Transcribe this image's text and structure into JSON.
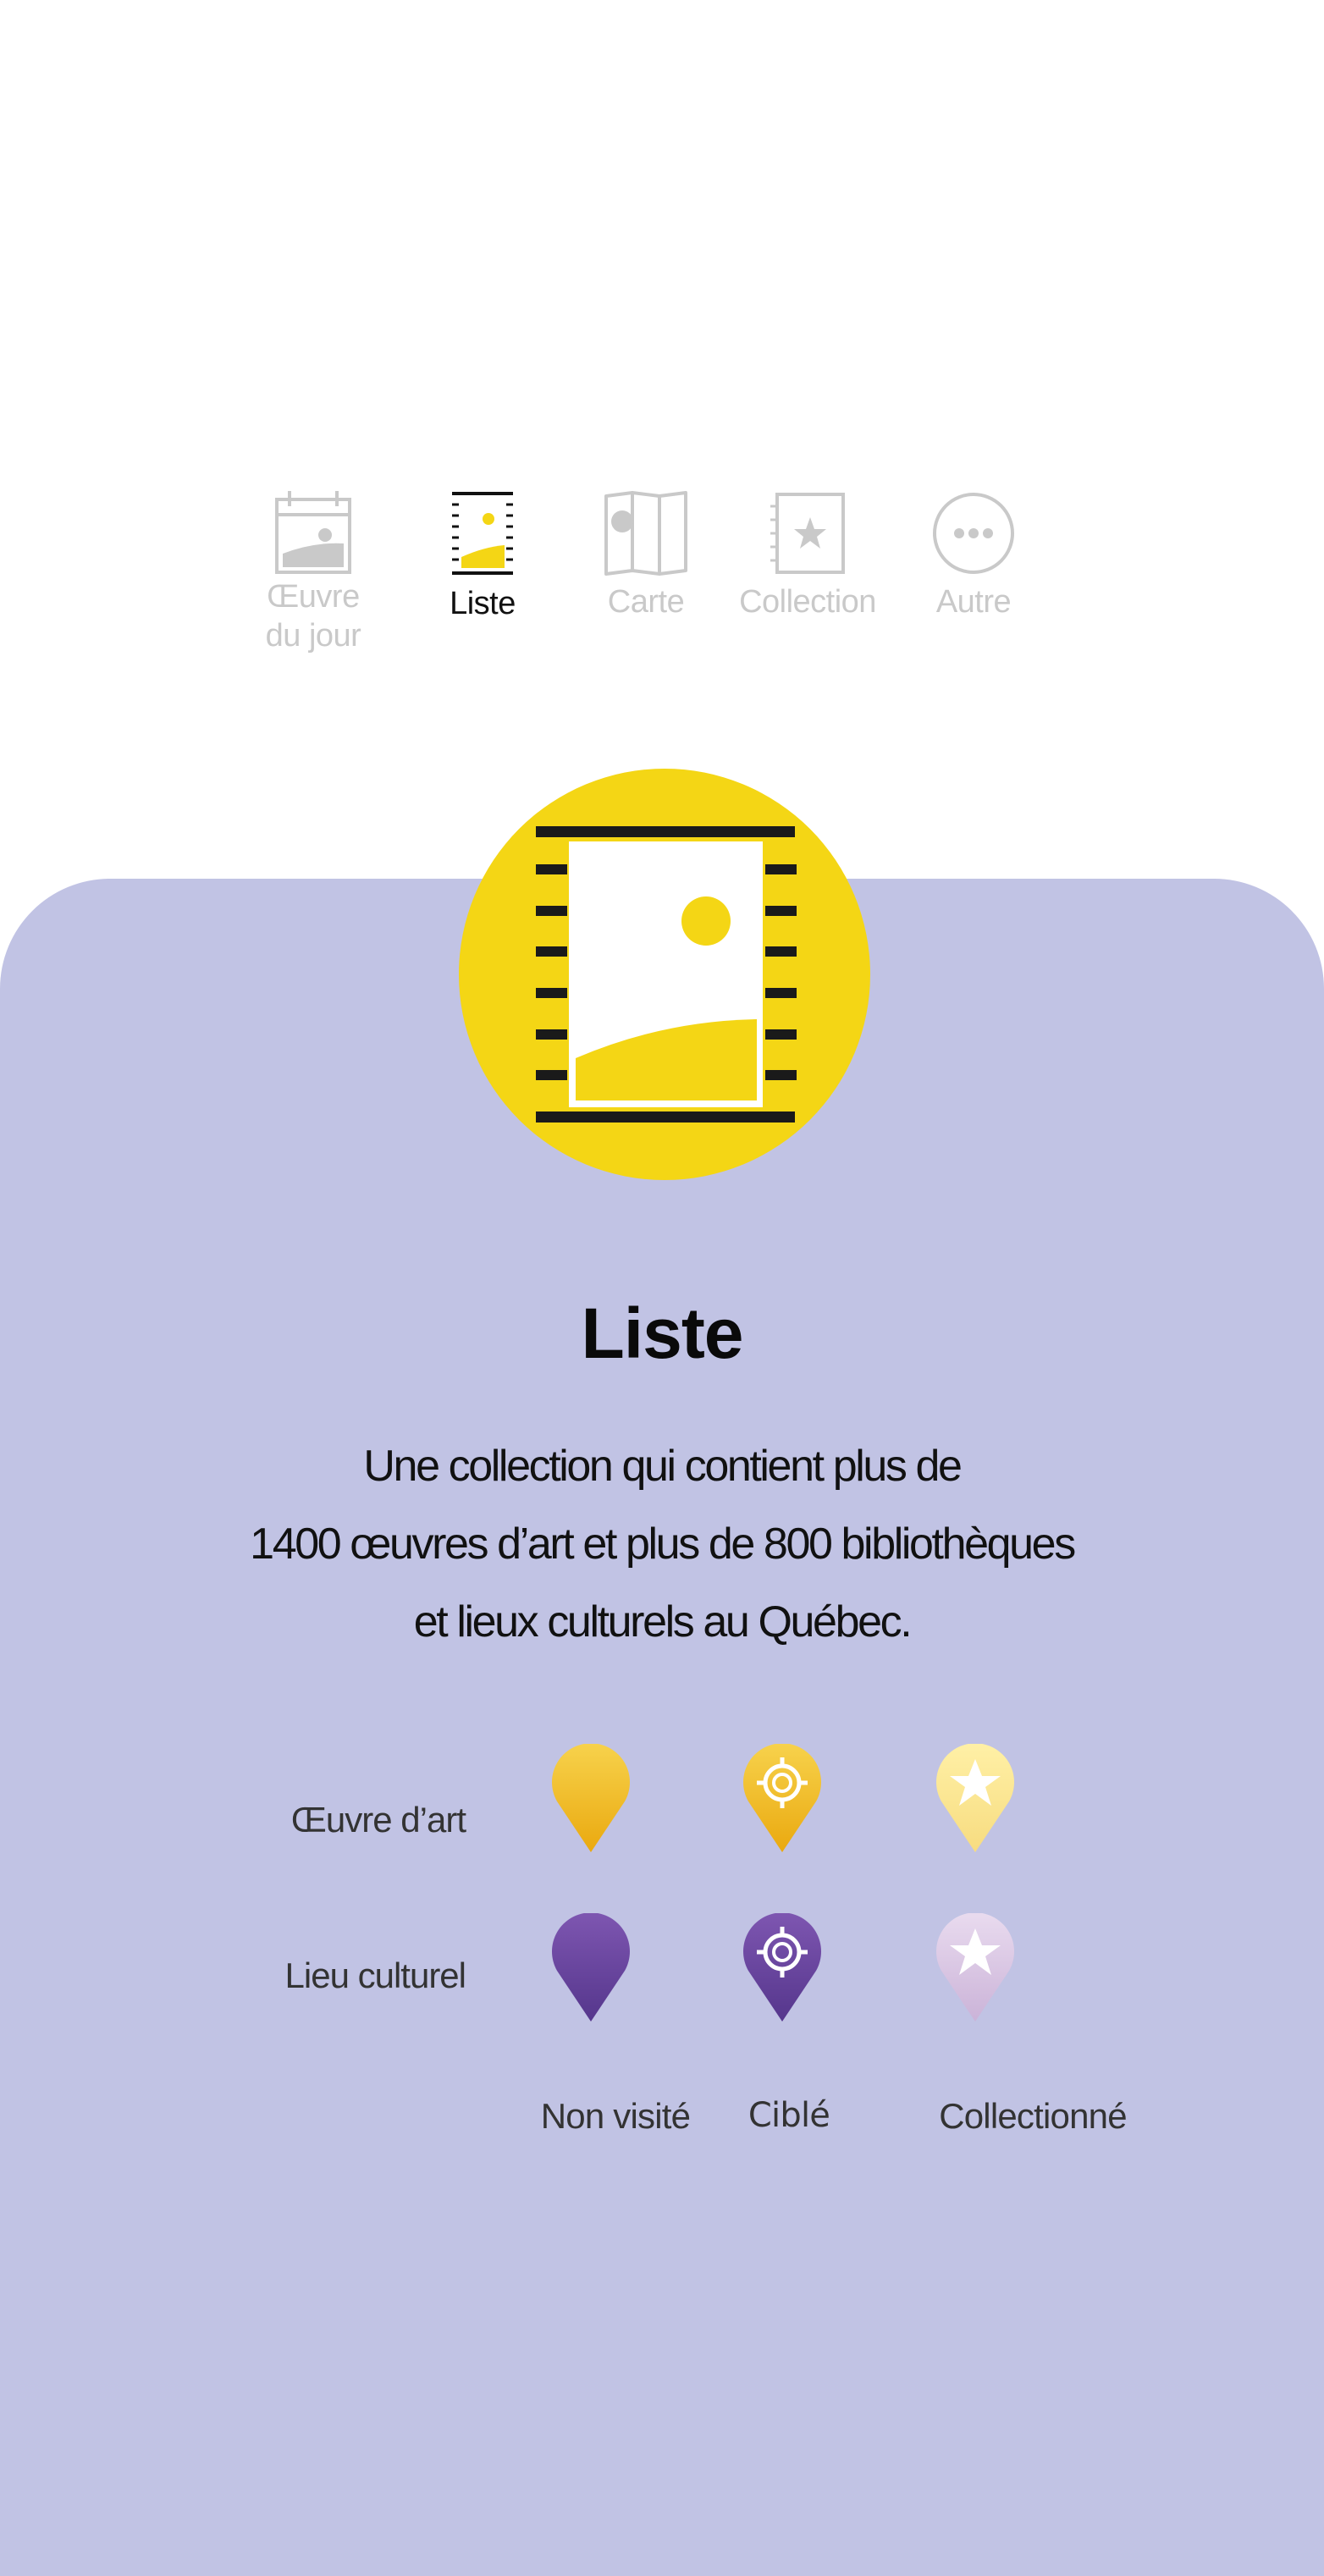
{
  "tabs": [
    {
      "id": "oeuvre",
      "label_line1": "Œuvre",
      "label_line2": "du jour",
      "active": false
    },
    {
      "id": "liste",
      "label": "Liste",
      "active": true
    },
    {
      "id": "carte",
      "label": "Carte",
      "active": false
    },
    {
      "id": "collection",
      "label": "Collection",
      "active": false
    },
    {
      "id": "autre",
      "label": "Autre",
      "active": false
    }
  ],
  "hero": {
    "icon": "list-gallery-icon",
    "title": "Liste",
    "description": [
      "Une collection qui contient plus de",
      "1400 œuvres d’art et plus de 800 bibliothèques",
      "et lieux culturels au Québec."
    ]
  },
  "legend": {
    "rows": [
      "Œuvre d’art",
      "Lieu culturel"
    ],
    "columns": [
      "Non visité",
      "Ciblé",
      "Collectionné"
    ]
  },
  "colors": {
    "accent_yellow": "#f4d615",
    "card_background": "#c1c3e4",
    "inactive_tab": "#c9c9c9",
    "pin_yellow": "#f0b826",
    "pin_purple": "#5e3f96"
  }
}
